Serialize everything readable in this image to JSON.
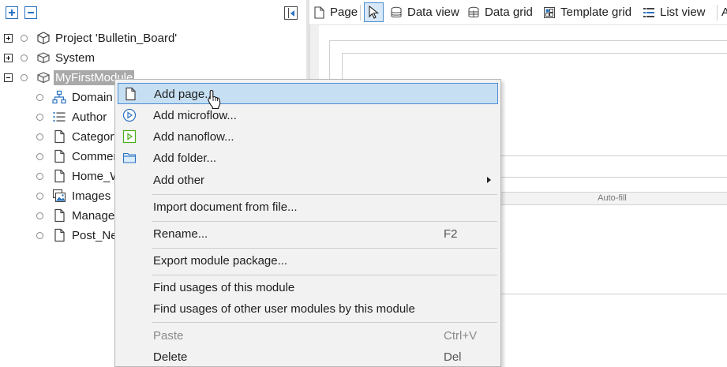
{
  "explorer": {
    "toolbar": {
      "expand_all": "expand-all",
      "collapse_all": "collapse-all",
      "collapse_panel": "collapse-panel"
    },
    "tree": [
      {
        "label": "Project 'Bulletin_Board'",
        "icon": "project-cube-icon",
        "expander": "plus",
        "level": 0
      },
      {
        "label": "System",
        "icon": "module-icon",
        "expander": "plus",
        "level": 0
      },
      {
        "label": "MyFirstModule",
        "icon": "module-icon",
        "expander": "minus",
        "level": 0,
        "selected": true
      },
      {
        "label": "Domain",
        "icon": "domain-model-icon",
        "level": 1
      },
      {
        "label": "Author",
        "icon": "list-icon",
        "level": 1
      },
      {
        "label": "Category",
        "icon": "page-icon",
        "level": 1
      },
      {
        "label": "Commer",
        "icon": "page-icon",
        "level": 1
      },
      {
        "label": "Home_W",
        "icon": "page-icon",
        "level": 1
      },
      {
        "label": "Images",
        "icon": "image-collection-icon",
        "level": 1
      },
      {
        "label": "Manage",
        "icon": "page-icon",
        "level": 1
      },
      {
        "label": "Post_Nev",
        "icon": "page-icon",
        "level": 1
      }
    ]
  },
  "editor_toolbar": {
    "items": [
      {
        "label": "Page",
        "icon": "page-icon"
      },
      {
        "label": "Data view",
        "icon": "data-view-icon"
      },
      {
        "label": "Data grid",
        "icon": "data-grid-icon"
      },
      {
        "label": "Template grid",
        "icon": "template-grid-icon"
      },
      {
        "label": "List view",
        "icon": "list-view-icon"
      },
      {
        "label": "A",
        "icon": "overflow"
      }
    ]
  },
  "canvas": {
    "autofill_label": "Auto-fill"
  },
  "context_menu": {
    "items": [
      {
        "label": "Add page...",
        "icon": "page-icon",
        "highlighted": true
      },
      {
        "label": "Add microflow...",
        "icon": "microflow-icon"
      },
      {
        "label": "Add nanoflow...",
        "icon": "nanoflow-icon"
      },
      {
        "label": "Add folder...",
        "icon": "folder-icon"
      },
      {
        "label": "Add other",
        "submenu": true
      },
      {
        "label": "Import document from file..."
      },
      {
        "label": "Rename...",
        "shortcut": "F2"
      },
      {
        "label": "Export module package..."
      },
      {
        "label": "Find usages of this module"
      },
      {
        "label": "Find usages of other user modules by this module"
      },
      {
        "label": "Paste",
        "shortcut": "Ctrl+V",
        "disabled": true
      },
      {
        "label": "Delete",
        "shortcut": "Del"
      }
    ]
  },
  "colors": {
    "accent": "#2a72c2",
    "menu_highlight": "#c6dff3",
    "menu_highlight_border": "#4d8fd1",
    "nanoflow_green": "#4cae1b",
    "selection_gray": "#a9a9a9"
  }
}
